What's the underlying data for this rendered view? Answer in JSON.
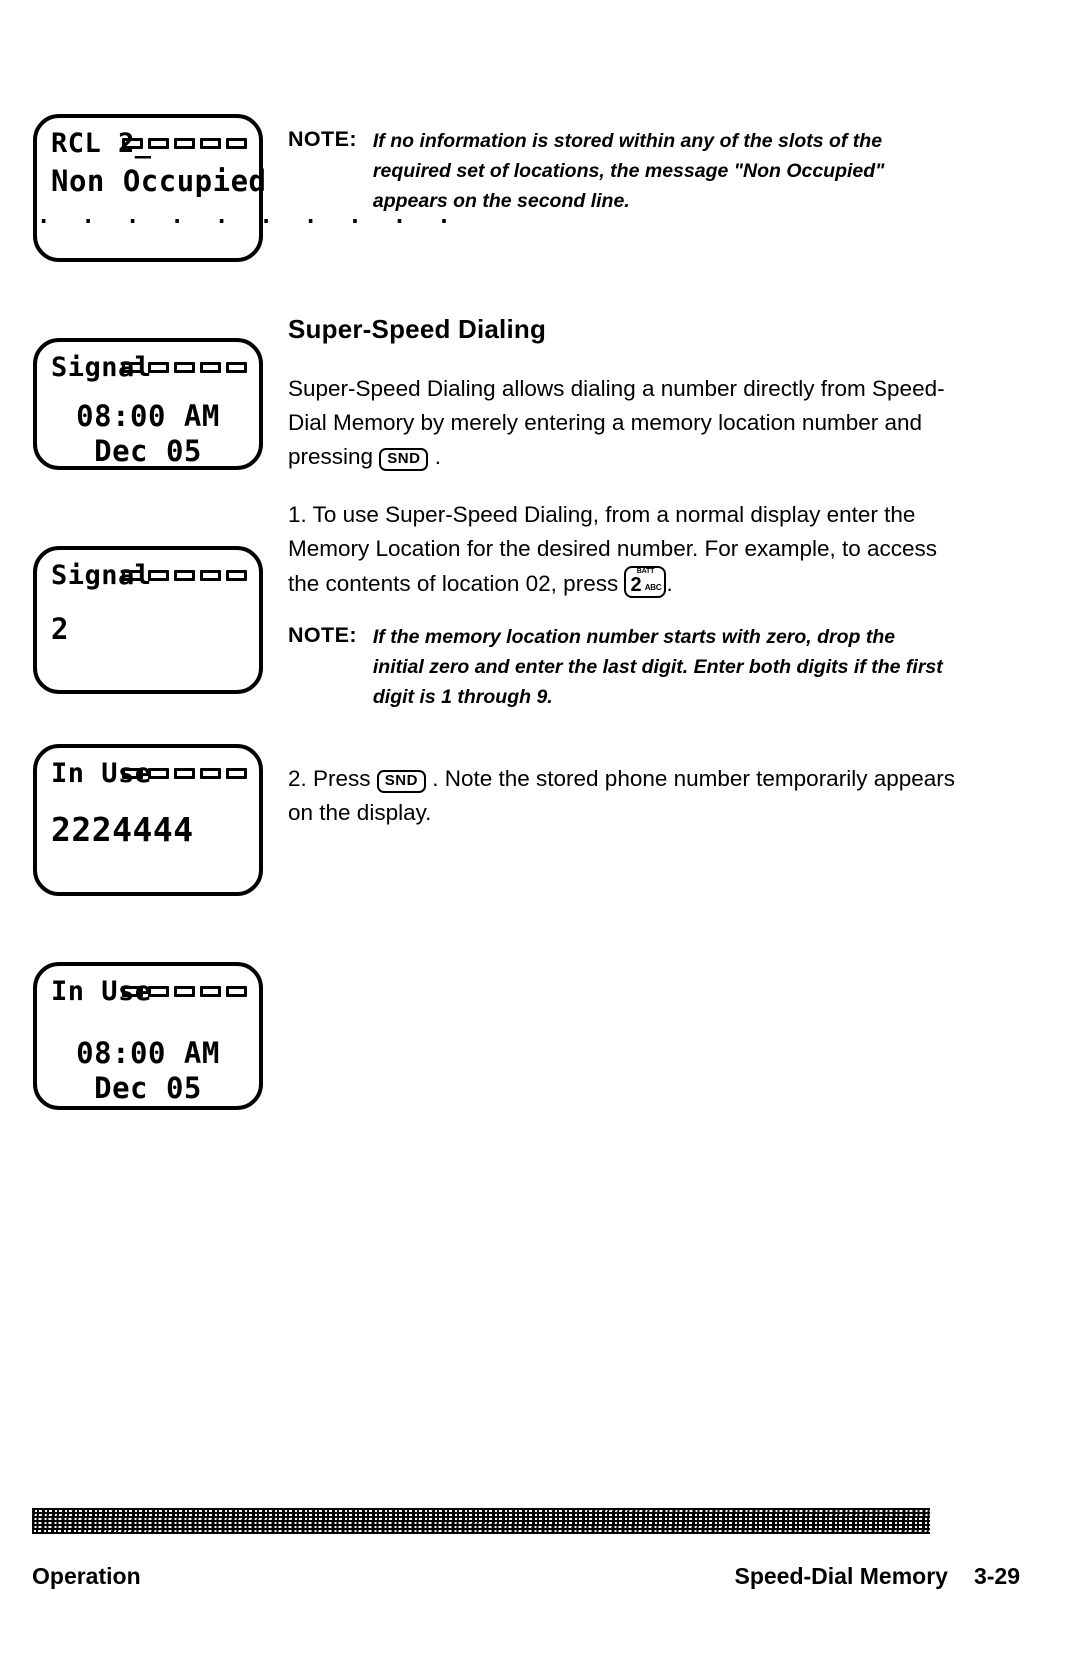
{
  "document": {
    "type": "phone-user-manual-page",
    "page_number": "3-29",
    "footer_left": "Operation",
    "footer_right_title": "Speed-Dial Memory"
  },
  "lcd_displays": [
    {
      "id": "rcl-non-occupied",
      "status": "RCL 2_",
      "bars": 5,
      "line2": "Non Occupied",
      "dots": ". . . . . . . . . ."
    },
    {
      "id": "signal-idle-clock",
      "status": "Signal",
      "bars": 5,
      "line2": "08:00 AM",
      "line3": "Dec 05"
    },
    {
      "id": "signal-memory-location-2",
      "status": "Signal",
      "bars": 5,
      "line2": "2"
    },
    {
      "id": "in-use-dialed-number",
      "status": "In Use",
      "bars": 5,
      "line2": "2224444"
    },
    {
      "id": "in-use-clock",
      "status": "In Use",
      "bars": 5,
      "line2": "08:00 AM",
      "line3": "Dec 05"
    }
  ],
  "content": {
    "note_label": "NOTE:",
    "note1_part1": "If no information is stored within any of the slots of the required set of locations, the message ",
    "note1_bold": "\"Non Occupied\"",
    "note1_part2": " appears on the second line.",
    "section_title": "Super-Speed Dialing",
    "intro_part1": "Super-Speed Dialing allows dialing a number directly from Speed-Dial Memory by merely entering a memory location number and pressing ",
    "intro_part2": " .",
    "step1_part1": "1.  To use Super-Speed Dialing, from a normal display enter the Memory Location for the desired number.  For example, to access the contents of location 02, press ",
    "step1_part2": ".",
    "note2": "If the memory location number starts with zero, drop the initial zero and enter the last digit.  Enter both digits if the first digit is 1 through 9.",
    "step2_part1": "2.  Press ",
    "step2_part2": " .  Note the stored phone number temporarily appears on the display."
  },
  "keys": {
    "snd_label": "SND",
    "num2_top": "BATT",
    "num2_digit": "2",
    "num2_letters": "ABC"
  }
}
